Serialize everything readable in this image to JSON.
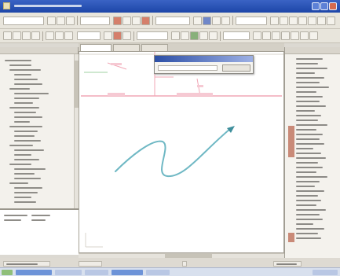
{
  "window": {
    "title": ""
  },
  "colors": {
    "titlebar": "#2a53b8",
    "chrome": "#dcd9d2",
    "guide_line": "#f1a7b6",
    "curve": "#6fb8c4",
    "panel_marker": "#c98a78"
  },
  "icons": [
    "app-icon",
    "minimize-icon",
    "maximize-icon",
    "close-icon",
    "arrowhead-icon"
  ],
  "toolbar": {
    "top_row_tool_count": 34,
    "bottom_row_tool_count": 28
  },
  "left_panel": {
    "header": "",
    "tree_items": []
  },
  "popup": {
    "title": "",
    "field_value": "",
    "button_label": ""
  },
  "canvas": {
    "top_labels": [],
    "guide_labels": []
  },
  "right_panel": {
    "header": "",
    "items": []
  },
  "status": {
    "cells": []
  }
}
